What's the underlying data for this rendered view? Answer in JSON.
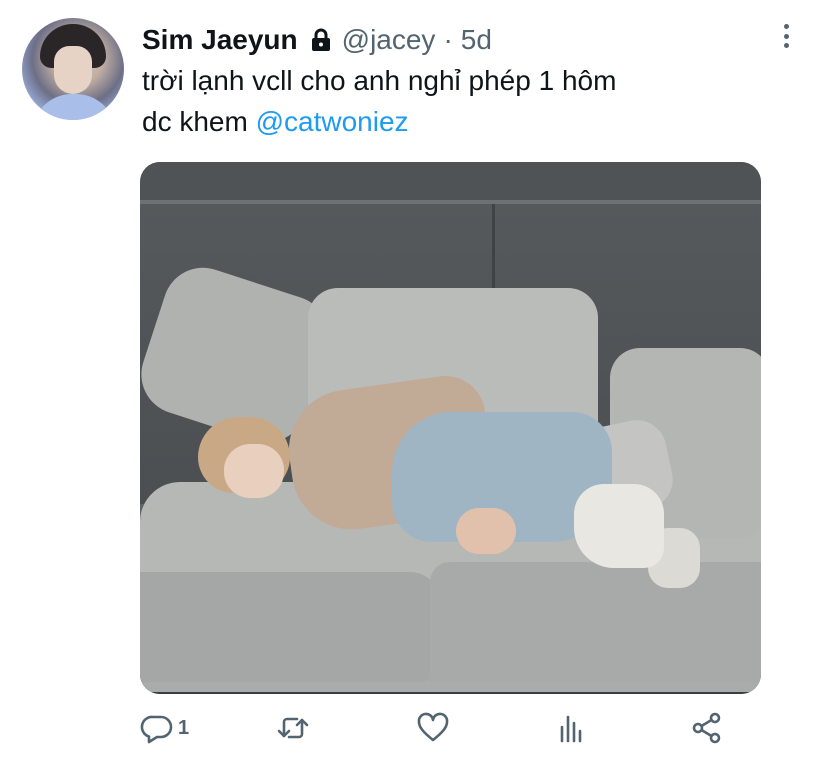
{
  "tweet": {
    "author_name": "Sim Jaeyun",
    "handle": "@jacey",
    "separator": "·",
    "time": "5d",
    "text_line1": "trời lạnh vcll cho anh nghỉ phép 1 hôm",
    "text_line2_prefix": "dc khem ",
    "mention": "@catwoniez",
    "protected": true
  },
  "actions": {
    "reply_icon": "reply-icon",
    "reply_count": "1",
    "retweet_icon": "retweet-icon",
    "like_icon": "heart-icon",
    "analytics_icon": "analytics-icon",
    "share_icon": "share-icon"
  },
  "colors": {
    "text": "#0f1419",
    "secondary": "#536471",
    "link": "#1d9bf0"
  }
}
